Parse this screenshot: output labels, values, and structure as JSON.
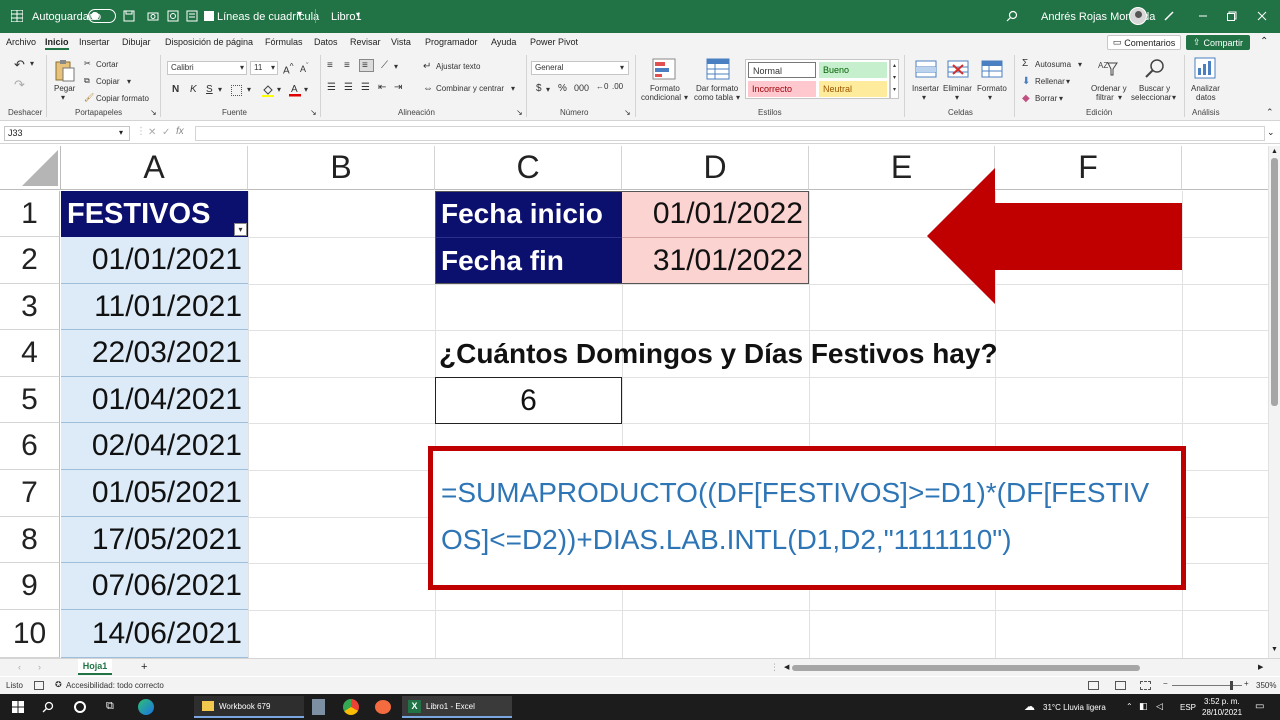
{
  "titlebar": {
    "autosave_label": "Autoguardado",
    "gridlines_label": "Líneas de cuadrícula",
    "workbook_name": "Libro1",
    "user_name": "Andrés Rojas Moncada"
  },
  "menu": {
    "tabs": [
      "Archivo",
      "Inicio",
      "Insertar",
      "Dibujar",
      "Disposición de página",
      "Fórmulas",
      "Datos",
      "Revisar",
      "Vista",
      "Programador",
      "Ayuda",
      "Power Pivot"
    ],
    "comments_label": "Comentarios",
    "share_label": "Compartir"
  },
  "ribbon": {
    "undo_group": "Deshacer",
    "clipboard": {
      "paste": "Pegar",
      "cut": "Cortar",
      "copy": "Copiar",
      "format_painter": "Copiar formato",
      "group": "Portapapeles"
    },
    "font": {
      "name": "Calibri",
      "size": "11",
      "bold": "N",
      "italic": "K",
      "underline": "S",
      "group": "Fuente"
    },
    "alignment": {
      "wrap": "Ajustar texto",
      "merge": "Combinar y centrar",
      "group": "Alineación"
    },
    "number": {
      "format": "General",
      "group": "Número"
    },
    "styles": {
      "cond_format_1": "Formato",
      "cond_format_2": "condicional",
      "table_format_1": "Dar formato",
      "table_format_2": "como tabla",
      "normal": "Normal",
      "good": "Bueno",
      "bad": "Incorrecto",
      "neutral": "Neutral",
      "group": "Estilos"
    },
    "cells": {
      "insert": "Insertar",
      "delete": "Eliminar",
      "format": "Formato",
      "group": "Celdas"
    },
    "editing": {
      "autosum": "Autosuma",
      "fill": "Rellenar",
      "clear": "Borrar",
      "sort_1": "Ordenar y",
      "sort_2": "filtrar",
      "find_1": "Buscar y",
      "find_2": "seleccionar",
      "group": "Edición"
    },
    "analysis": {
      "analyze_1": "Analizar",
      "analyze_2": "datos",
      "group": "Análisis"
    }
  },
  "formula_bar": {
    "cell_ref": "J33",
    "formula": ""
  },
  "grid": {
    "columns": [
      "A",
      "B",
      "C",
      "D",
      "E",
      "F"
    ],
    "rows": [
      "1",
      "2",
      "3",
      "4",
      "5",
      "6",
      "7",
      "8",
      "9",
      "10"
    ],
    "festivos_header": "FESTIVOS",
    "festivos": [
      "01/01/2021",
      "11/01/2021",
      "22/03/2021",
      "01/04/2021",
      "02/04/2021",
      "01/05/2021",
      "17/05/2021",
      "07/06/2021",
      "14/06/2021"
    ],
    "start_label": "Fecha inicio",
    "start_value": "01/01/2022",
    "end_label": "Fecha fin",
    "end_value": "31/01/2022",
    "question": "¿Cuántos Domingos y Días Festivos hay?",
    "answer": "6",
    "formula_line1": "=SUMAPRODUCTO((DF[FESTIVOS]>=D1)*(DF[FESTIV",
    "formula_line2": "OS]<=D2))+DIAS.LAB.INTL(D1,D2,\"1111110\")"
  },
  "sheet": {
    "tab_name": "Hoja1"
  },
  "status": {
    "ready": "Listo",
    "accessibility": "Accesibilidad: todo correcto",
    "zoom": "350%"
  },
  "taskbar": {
    "app1": "Workbook 679",
    "app2": "Libro1 - Excel",
    "weather": "31°C  Lluvia ligera",
    "lang": "ESP",
    "time": "3:52 p. m.",
    "date": "28/10/2021"
  },
  "colors": {
    "excel_green": "#217346",
    "navy": "#0b0f6e",
    "pink": "#fbd3d1",
    "light_blue": "#dcebf7",
    "red": "#c00000",
    "formula_blue": "#2e75b6"
  }
}
